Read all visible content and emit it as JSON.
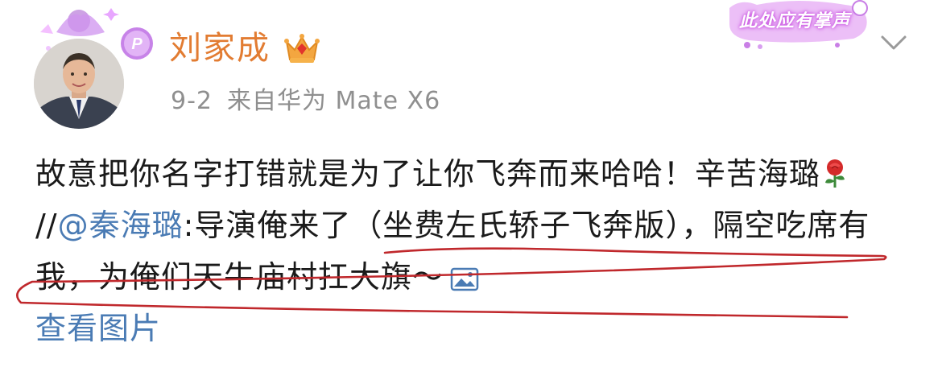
{
  "post": {
    "username": "刘家成",
    "date": "9-2",
    "source": "来自华为 Mate X6",
    "text_intro": "故意把你名字打错就是为了让你飞奔而来哈哈！辛苦海璐",
    "repost_prefix": " //",
    "mention": "@秦海璐",
    "repost_text": ":导演俺来了（坐费左氏轿子飞奔版），隔空吃席有我，为俺们天牛庙村扛大旗～",
    "view_picture": "查看图片"
  },
  "decoration": {
    "applause_text": "此处应有掌声"
  },
  "icons": {
    "avatar": "avatar-photo",
    "verified": "verified-v-badge-icon",
    "crown": "crown-icon",
    "rose": "rose-emoji-icon",
    "image": "image-icon",
    "menu": "chevron-down-icon"
  },
  "colors": {
    "username": "#e27c32",
    "link": "#4a7bb4",
    "meta": "#8f8f8f",
    "annotation": "#c0282c"
  }
}
